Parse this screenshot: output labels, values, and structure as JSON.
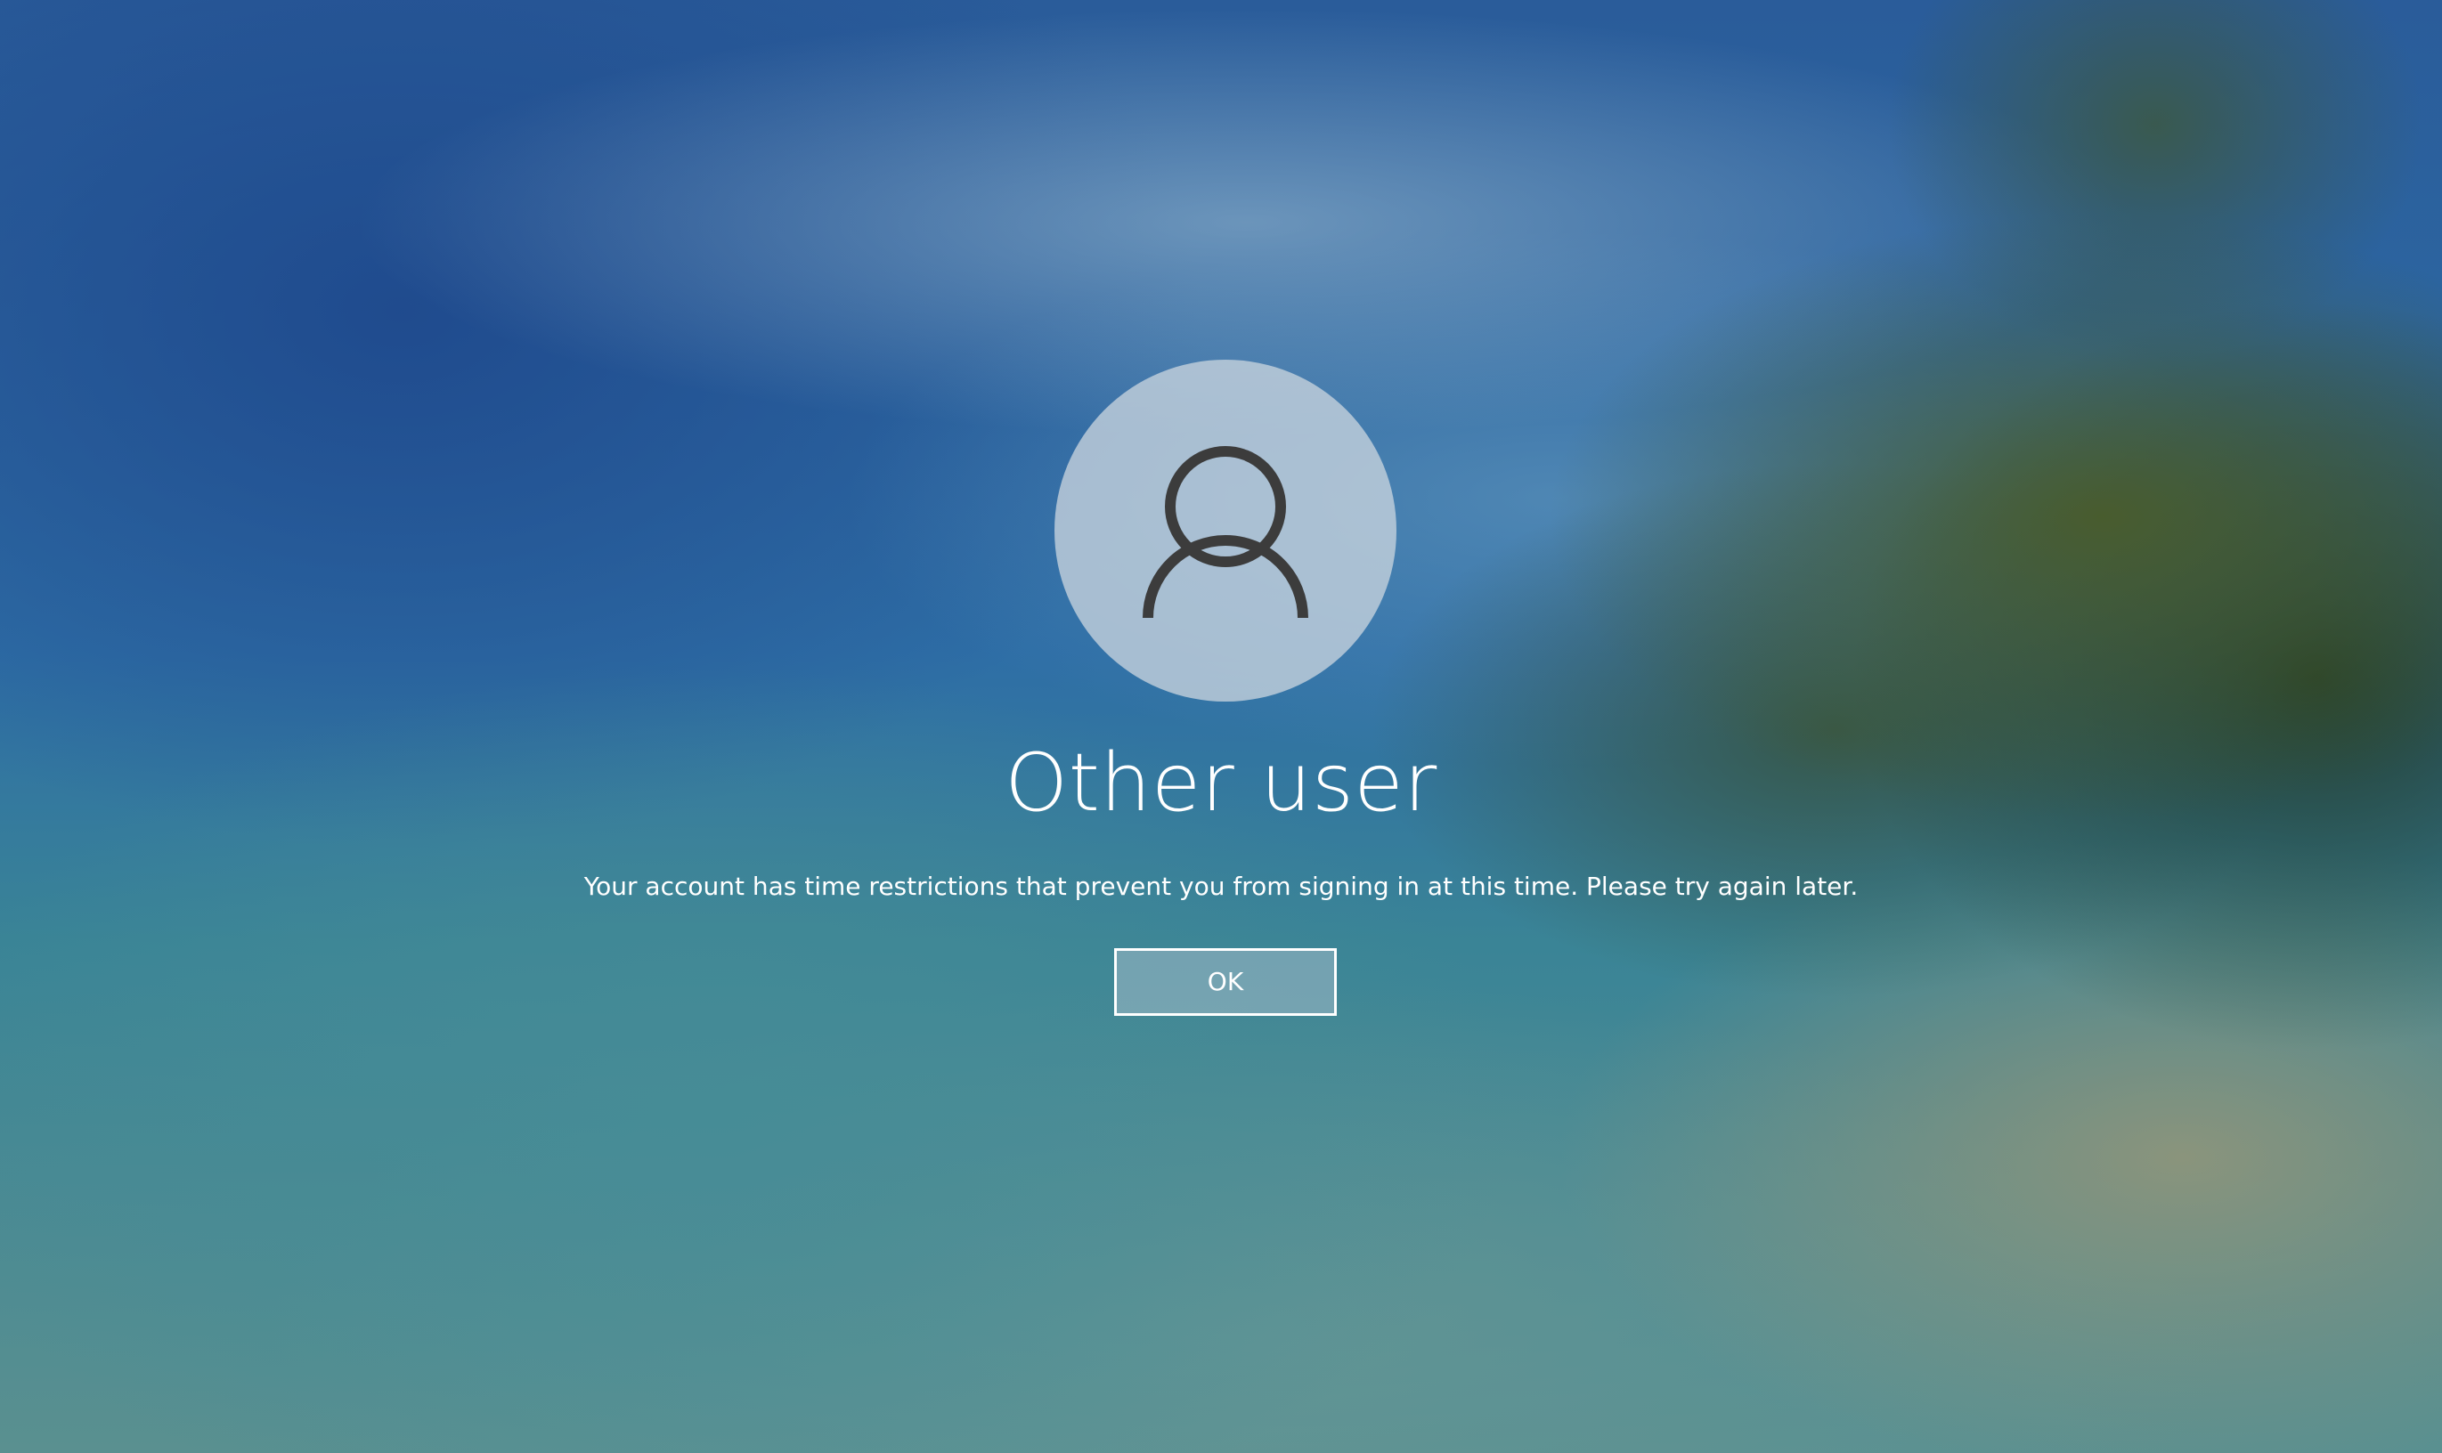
{
  "user": {
    "name": "Other user",
    "avatar_icon": "user-avatar-icon"
  },
  "message": "Your account has time restrictions that prevent you from signing in at this time. Please try again later.",
  "ok_button": {
    "label": "OK"
  },
  "colors": {
    "text": "#ffffff",
    "avatar_bg": "#c8d4de",
    "avatar_glyph": "#3c3c3c"
  }
}
